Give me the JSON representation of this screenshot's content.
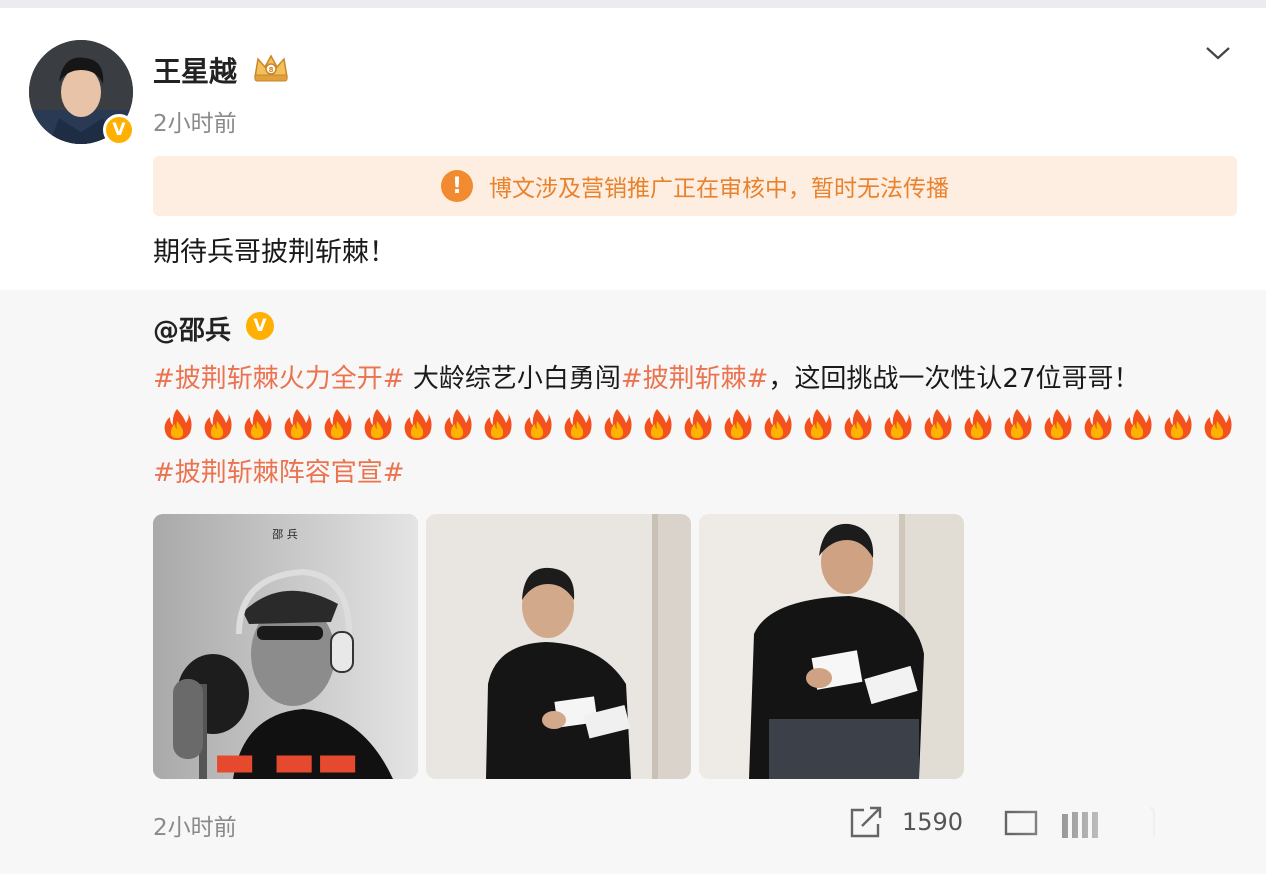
{
  "post": {
    "username": "王星越",
    "time": "2小时前",
    "notice": "博文涉及营销推广正在审核中，暂时无法传播",
    "text": "期待兵哥披荆斩棘！",
    "verified_badge": "V",
    "notice_icon": "!"
  },
  "repost": {
    "user": "@邵兵",
    "verified_badge": "V",
    "tag1": "#披荆斩棘火力全开#",
    "text1": " 大龄综艺小白勇闯",
    "tag2": "#披荆斩棘#",
    "text2": "，这回挑战一次性认27位哥哥！",
    "fire_emoji_count": 27,
    "tag3": "#披荆斩棘阵容官宣#",
    "photo1_caption": "邵 兵",
    "time": "2小时前",
    "share_count": "1590"
  },
  "colors": {
    "tag": "#eb7350",
    "notice_bg": "#fdeee1",
    "notice_text": "#e9822d",
    "verified": "#ffb000"
  },
  "icons": [
    "chevron-down-icon",
    "crown-icon",
    "warning-icon",
    "fire-icon",
    "share-icon",
    "comment-icon",
    "like-icon",
    "more-icon"
  ]
}
